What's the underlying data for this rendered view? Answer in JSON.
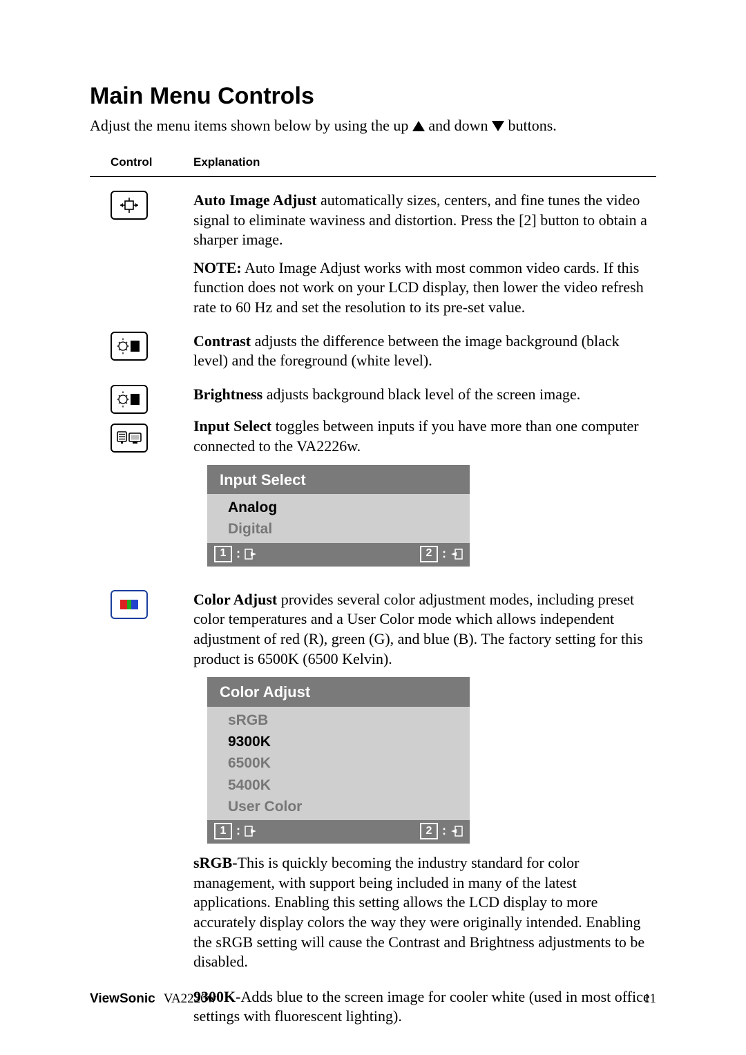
{
  "heading": "Main Menu Controls",
  "intro_before_up": "Adjust the menu items shown below by using the up ",
  "intro_mid": " and down ",
  "intro_after_down": " buttons.",
  "table": {
    "control_header": "Control",
    "explanation_header": "Explanation"
  },
  "auto_image": {
    "label": "Auto Image Adjust",
    "text1": " automatically sizes, centers, and fine tunes the video signal to eliminate waviness and distortion. Press the [2] button to obtain a sharper image.",
    "note_label": "NOTE:",
    "note_text": " Auto Image Adjust works with most common video cards. If this function does not work on your LCD display, then lower the video refresh rate to 60 Hz and set the resolution to its pre-set value."
  },
  "contrast": {
    "label": "Contrast",
    "text": " adjusts the difference between the image background  (black level) and the foreground (white level)."
  },
  "brightness": {
    "label": "Brightness",
    "text": " adjusts background black level of the screen image."
  },
  "input_select": {
    "label": "Input Select",
    "text": " toggles between inputs if you have more than one computer connected to the VA2226w.",
    "osd": {
      "title": "Input Select",
      "items": [
        "Analog",
        "Digital"
      ],
      "selected_index": 0,
      "key1": "1",
      "key2": "2"
    }
  },
  "color_adjust": {
    "label": "Color Adjust",
    "text": " provides several color adjustment modes, including preset color temperatures and a User Color mode which allows independent adjustment of red (R), green (G), and blue (B). The factory setting for this product is 6500K (6500 Kelvin).",
    "osd": {
      "title": "Color Adjust",
      "items": [
        "sRGB",
        "9300K",
        "6500K",
        "5400K",
        "User Color"
      ],
      "selected_index": 1,
      "key1": "1",
      "key2": "2"
    },
    "srgb_label": "sRGB-",
    "srgb_text": "This is quickly becoming the industry standard for color management, with support being included in many of the latest applications. Enabling this setting allows the LCD display to more accurately display colors the way they were originally intended. Enabling the sRGB setting will cause the Contrast and Brightness adjustments to be disabled.",
    "k9300_label": "9300K-",
    "k9300_text": "Adds blue to the screen image for cooler white (used in most office settings with fluorescent lighting)."
  },
  "footer": {
    "brand": "ViewSonic",
    "model": "VA2226w",
    "page": "11"
  }
}
